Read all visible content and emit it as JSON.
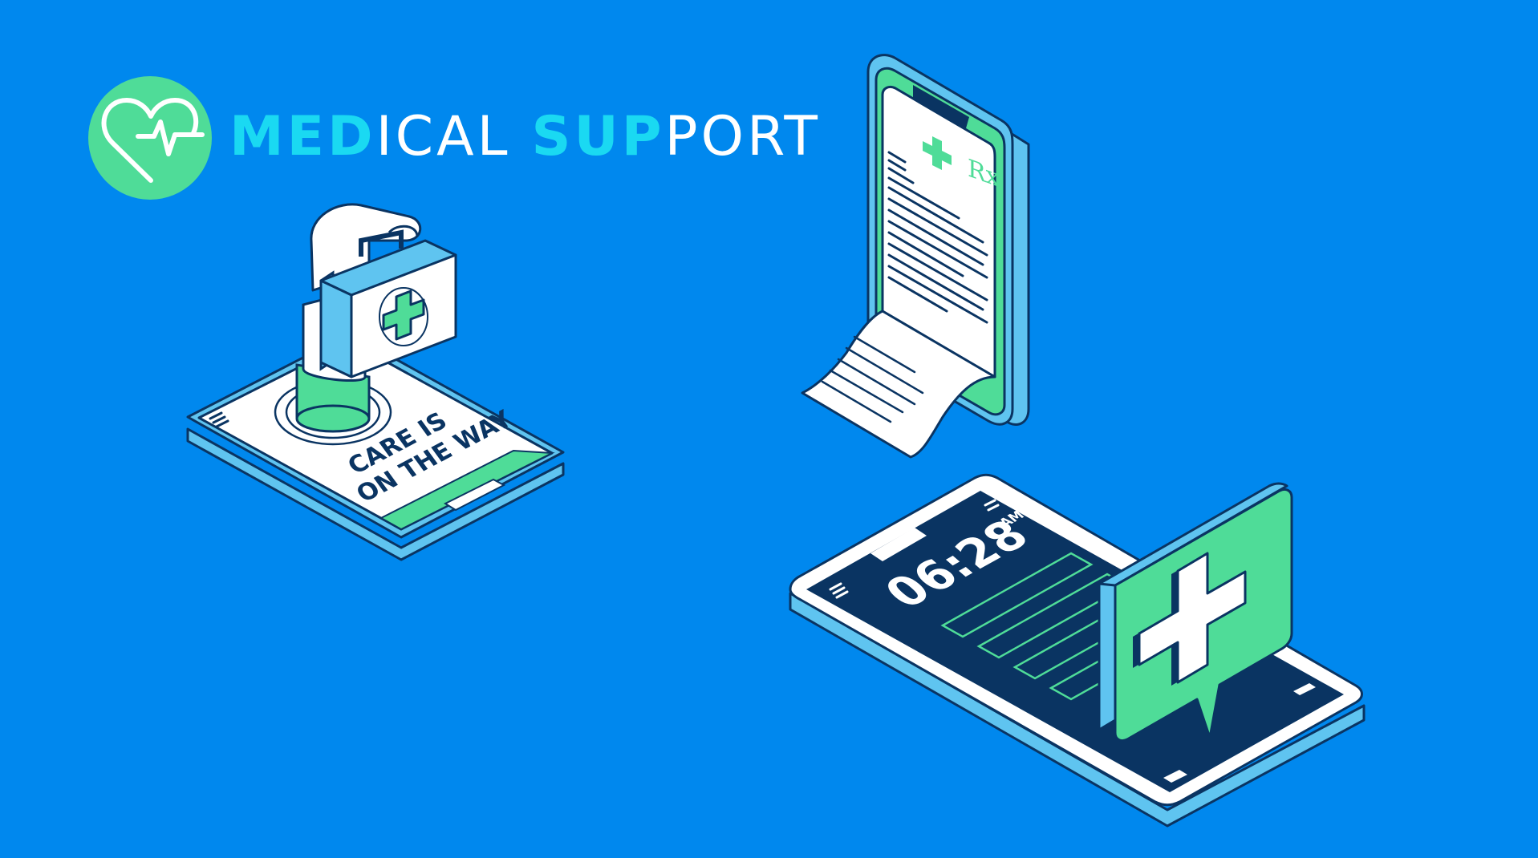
{
  "brand": {
    "word1_highlight": "MED",
    "word1_rest": "ICAL",
    "word2_highlight": "SUP",
    "word2_rest": "PORT",
    "highlight_color": "#1ad9f2",
    "rest_color": "#ffffff",
    "logo_icon": "heart-pulse-icon",
    "logo_color": "#4fdc98"
  },
  "care_phone": {
    "line1": "CARE IS",
    "line2": "ON THE WAY",
    "icon": "first-aid-kit-icon"
  },
  "prescription_phone": {
    "rx_label": "Rx",
    "icon": "medical-cross-icon"
  },
  "clock_phone": {
    "time": "06:28",
    "meridiem": "AM",
    "icon": "medical-cross-bubble-icon"
  },
  "colors": {
    "background": "#0088ee",
    "navy": "#0a3462",
    "mint": "#4fdc98",
    "light_blue": "#5fc4f0",
    "white": "#ffffff"
  }
}
